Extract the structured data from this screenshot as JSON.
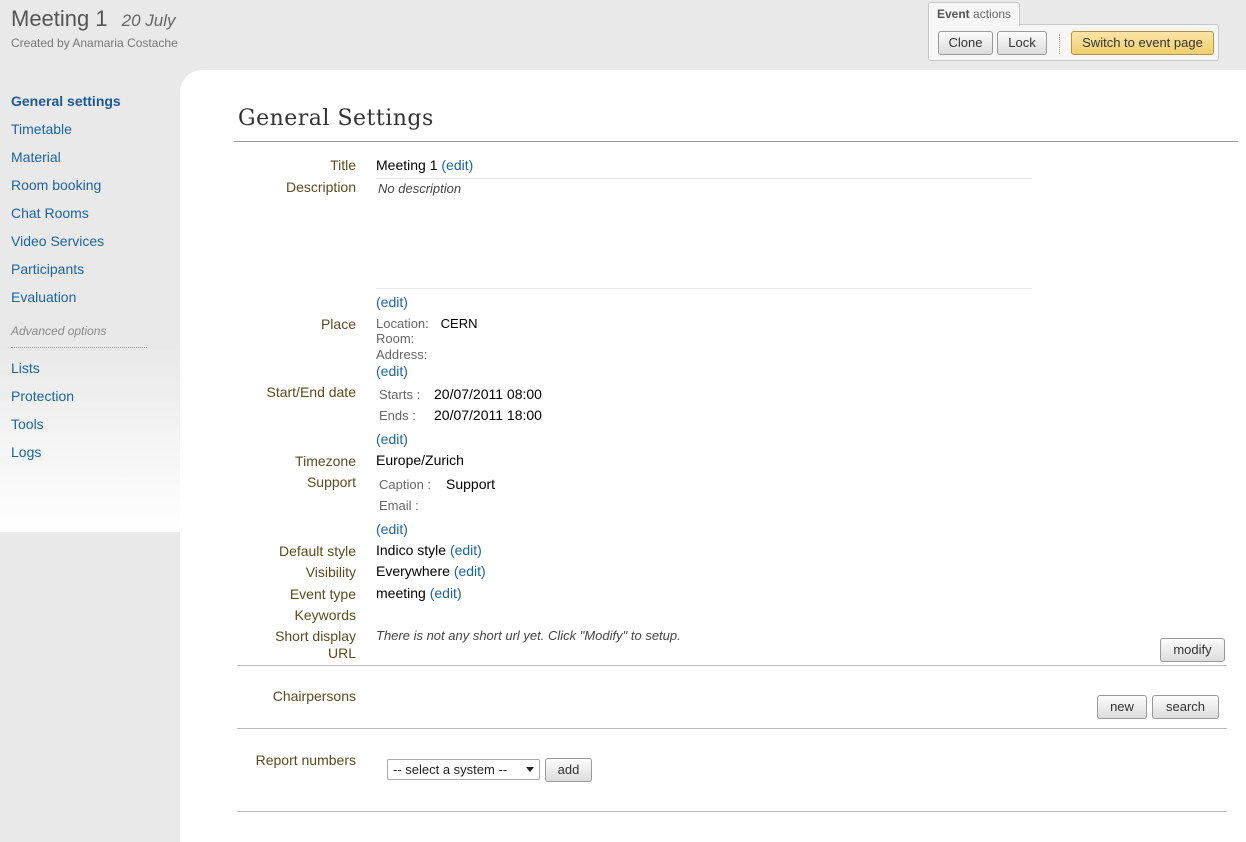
{
  "header": {
    "title": "Meeting 1",
    "date": "20 July",
    "created_by": "Created by Anamaria Costache"
  },
  "event_actions": {
    "tab_bold": "Event",
    "tab_rest": " actions",
    "clone": "Clone",
    "lock": "Lock",
    "switch": "Switch to event page"
  },
  "sidebar": {
    "items": [
      "General settings",
      "Timetable",
      "Material",
      "Room booking",
      "Chat Rooms",
      "Video Services",
      "Participants",
      "Evaluation"
    ],
    "advanced_label": "Advanced options",
    "advanced_items": [
      "Lists",
      "Protection",
      "Tools",
      "Logs"
    ]
  },
  "main": {
    "page_title": "General Settings",
    "edit": "(edit)",
    "labels": {
      "title": "Title",
      "description": "Description",
      "place": "Place",
      "start_end": "Start/End date",
      "timezone": "Timezone",
      "support": "Support",
      "default_style": "Default style",
      "visibility": "Visibility",
      "event_type": "Event type",
      "keywords": "Keywords",
      "short_url_1": "Short display",
      "short_url_2": "URL",
      "chairpersons": "Chairpersons",
      "report_numbers": "Report numbers"
    },
    "values": {
      "title": "Meeting 1",
      "description": "No description",
      "location_label": "Location:",
      "location": "CERN",
      "room_label": "Room:",
      "address_label": "Address:",
      "starts_label": "Starts :",
      "starts": "20/07/2011 08:00",
      "ends_label": "Ends :",
      "ends": "20/07/2011 18:00",
      "timezone": "Europe/Zurich",
      "caption_label": "Caption :",
      "caption": "Support",
      "email_label": "Email :",
      "default_style": "Indico style",
      "visibility": "Everywhere",
      "event_type": "meeting",
      "short_url": "There is not any short url yet. Click \"Modify\" to setup."
    },
    "buttons": {
      "modify": "modify",
      "new": "new",
      "search": "search",
      "add": "add"
    },
    "report_select": "-- select a system --"
  }
}
